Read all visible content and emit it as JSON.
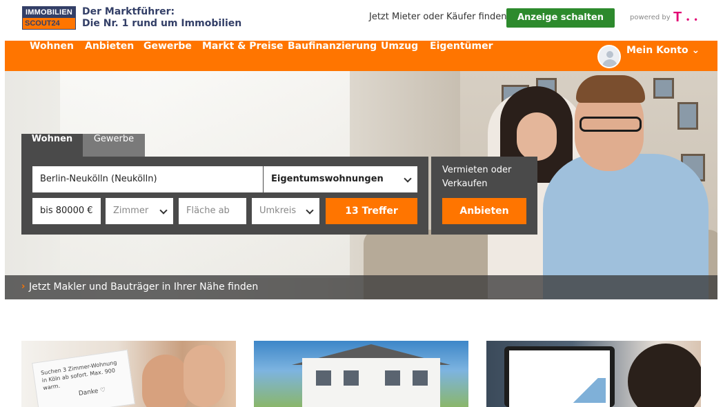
{
  "header": {
    "logo_top": "IMMOBILIEN",
    "logo_bottom": "SCOUT24",
    "claim_line1": "Der Marktführer:",
    "claim_line2": "Die Nr. 1 rund um Immobilien",
    "find_text": "Jetzt Mieter oder Käufer finden",
    "cta_label": "Anzeige schalten",
    "powered_by": "powered by",
    "telekom_logo": "T",
    "telekom_dots": "• •"
  },
  "nav": {
    "items": [
      "Wohnen",
      "Anbieten",
      "Gewerbe",
      "Markt & Preise",
      "Baufinanzierung",
      "Umzug",
      "Eigentümer"
    ],
    "account_label": "Mein Konto ⌄"
  },
  "search": {
    "tabs": [
      "Wohnen",
      "Gewerbe"
    ],
    "active_tab": "Wohnen",
    "location_value": "Berlin-Neukölln (Neukölln)",
    "type_value": "Eigentumswohnungen",
    "price_value": "bis 80000 €",
    "rooms_placeholder": "Zimmer",
    "area_placeholder": "Fläche ab",
    "radius_placeholder": "Umkreis",
    "submit_label": "13 Treffer"
  },
  "sell": {
    "text": "Vermieten oder Verkaufen",
    "button_label": "Anbieten"
  },
  "makler": {
    "chevron": "›",
    "text": "Jetzt Makler und Bauträger in Ihrer Nähe finden"
  },
  "cards": {
    "note_text": "Suchen 3 Zimmer-Wohnung in Köln ab sofort. Max. 900 warm.",
    "note_thanks": "Danke ♡"
  },
  "colors": {
    "brand_orange": "#ff7500",
    "brand_navy": "#333f67",
    "cta_green": "#2d8a2d",
    "telekom_magenta": "#e20074"
  }
}
